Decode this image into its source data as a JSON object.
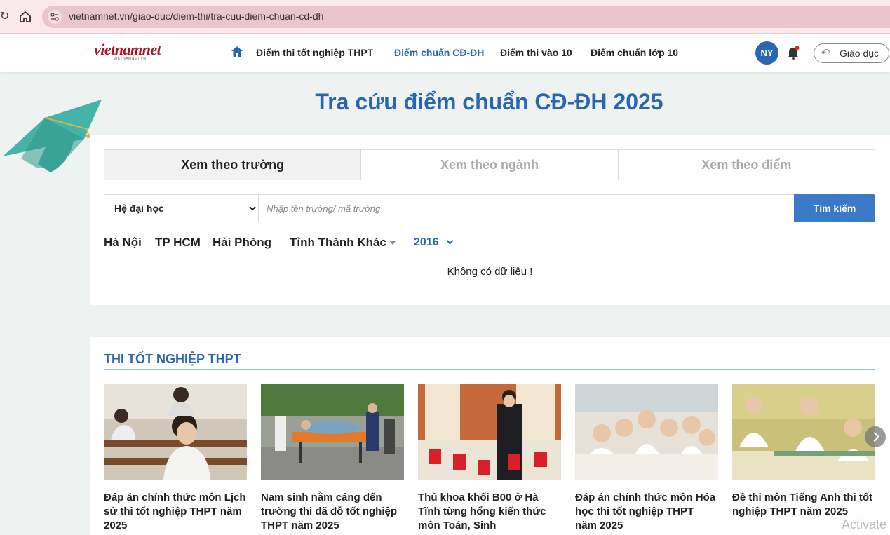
{
  "browser": {
    "url": "vietnamnet.vn/giao-duc/diem-thi/tra-cuu-diem-chuan-cd-dh"
  },
  "header": {
    "logo_text": "vietnamnet",
    "logo_sub": "VIETNAMNET.VN",
    "nav": [
      {
        "label": "Điểm thi tốt nghiệp THPT",
        "active": false
      },
      {
        "label": "Điểm chuẩn CĐ-ĐH",
        "active": true
      },
      {
        "label": "Điểm thi vào 10",
        "active": false
      },
      {
        "label": "Điểm chuẩn lớp 10",
        "active": false
      }
    ],
    "avatar_initials": "NY",
    "section_button": "Giáo dục"
  },
  "hero": {
    "title": "Tra cứu điểm chuẩn CĐ-ĐH 2025"
  },
  "search": {
    "tabs": [
      {
        "label": "Xem theo trường",
        "active": true
      },
      {
        "label": "Xem theo ngành",
        "active": false
      },
      {
        "label": "Xem theo điểm",
        "active": false
      }
    ],
    "level_selected": "Hệ đại học",
    "input_placeholder": "Nhập tên trường/ mã trường",
    "button_label": "Tìm kiếm",
    "filters": [
      "Hà Nội",
      "TP HCM",
      "Hải Phòng",
      "Tỉnh Thành Khác"
    ],
    "year": "2016",
    "no_data": "Không có dữ liệu !"
  },
  "news": {
    "section_title": "THI TỐT NGHIỆP THPT",
    "items": [
      {
        "headline": "Đáp án chính thức môn Lịch sử thi tốt nghiệp THPT năm 2025"
      },
      {
        "headline": "Nam sinh nằm cáng đến trường thi đã đỗ tốt nghiệp THPT năm 2025"
      },
      {
        "headline": "Thủ khoa khối B00 ở Hà Tĩnh từng hổng kiến thức môn Toán, Sinh"
      },
      {
        "headline": "Đáp án chính thức môn Hóa học thi tốt nghiệp THPT năm 2025"
      },
      {
        "headline": "Đề thi môn Tiếng Anh thi tốt nghiệp THPT năm 2025"
      }
    ]
  },
  "watermark": "Activate",
  "colors": {
    "brand_blue": "#2a66b0",
    "button_blue": "#3a79c8",
    "logo_red": "#b3111c"
  }
}
